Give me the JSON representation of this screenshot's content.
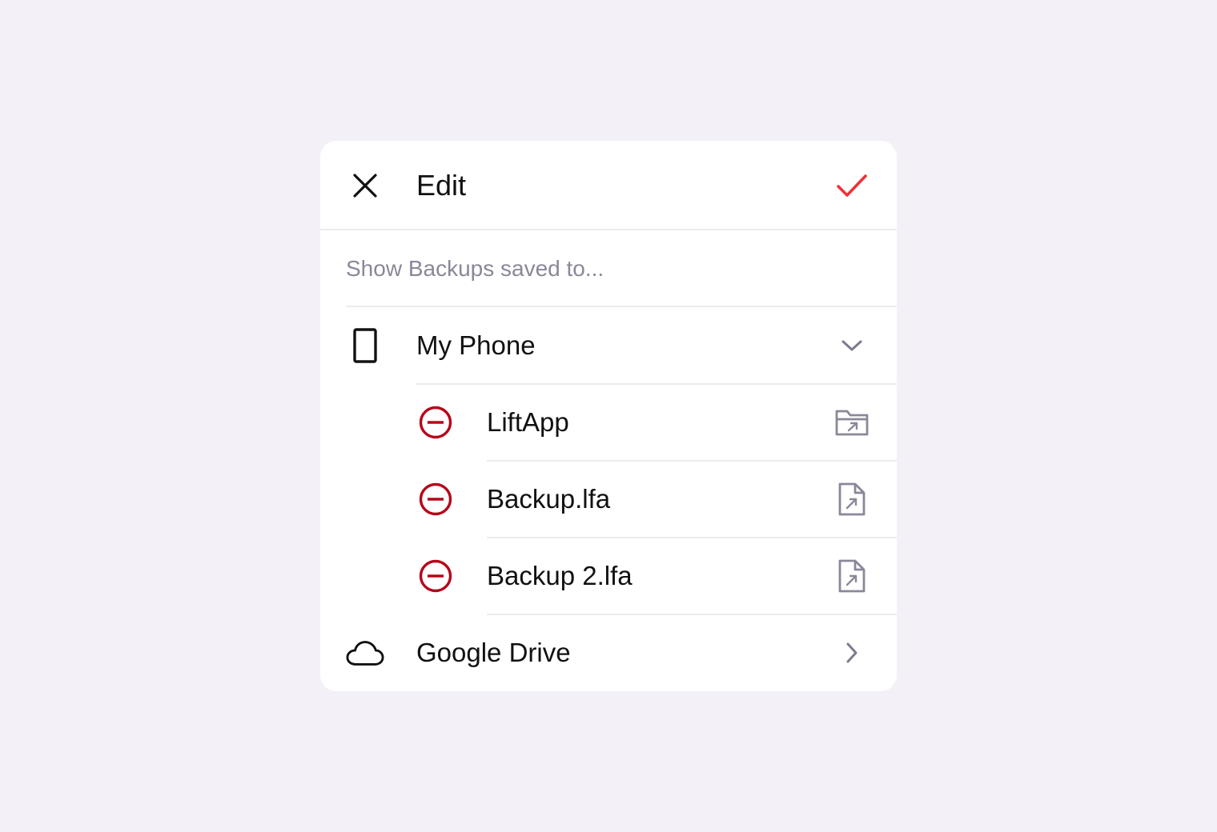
{
  "dialog": {
    "title": "Edit",
    "subtitle": "Show Backups saved to...",
    "accent_color": "#f0303a",
    "remove_color": "#b5061a"
  },
  "locations": [
    {
      "label": "My Phone",
      "icon": "phone-icon",
      "expanded": true,
      "items": [
        {
          "label": "LiftApp",
          "icon": "folder-link-icon"
        },
        {
          "label": "Backup.lfa",
          "icon": "file-link-icon"
        },
        {
          "label": "Backup 2.lfa",
          "icon": "file-link-icon"
        }
      ]
    },
    {
      "label": "Google Drive",
      "icon": "cloud-icon",
      "expanded": false
    }
  ]
}
